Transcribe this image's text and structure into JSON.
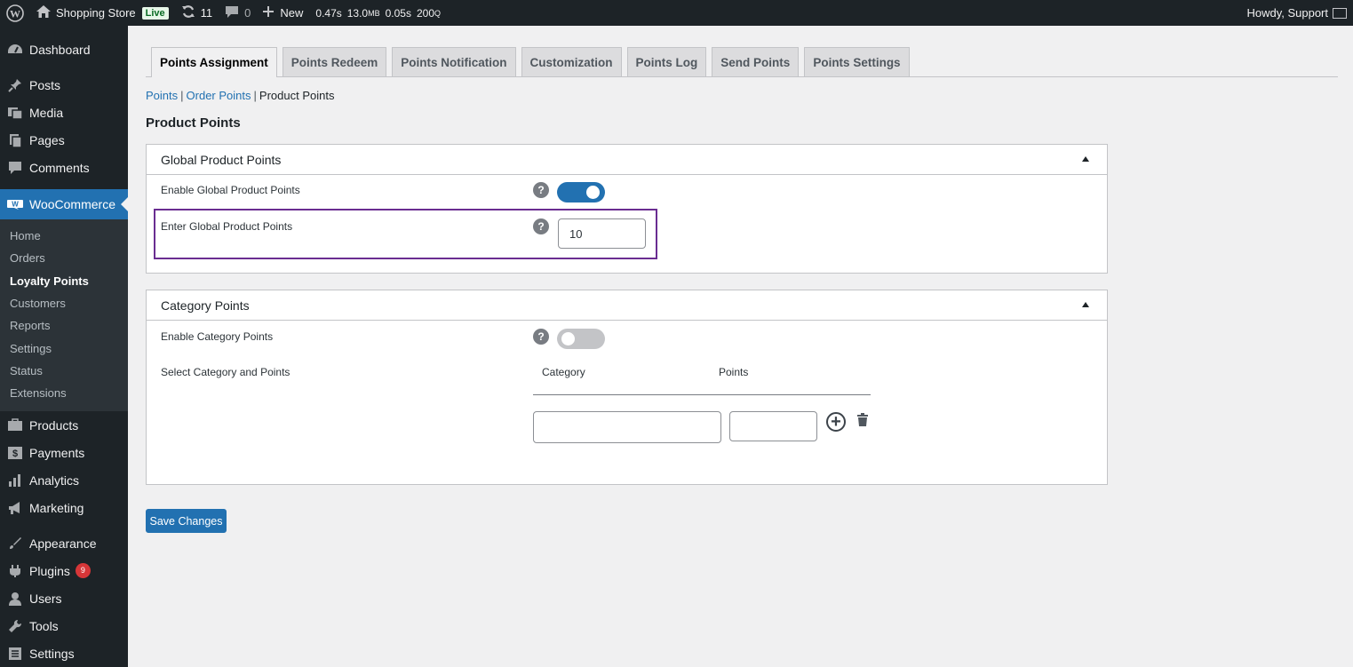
{
  "adminbar": {
    "site_name": "Shopping Store",
    "live_label": "Live",
    "updates_count": "11",
    "comments_count": "0",
    "new_label": "New",
    "perf_time": "0.47s",
    "perf_mem": "13.0",
    "perf_mem_unit": "MB",
    "perf_query_time": "0.05s",
    "perf_queries": "200",
    "perf_queries_unit": "Q",
    "howdy": "Howdy, Support"
  },
  "sidebar": {
    "top_items": [
      {
        "label": "Dashboard",
        "icon": "dashboard-icon"
      },
      {
        "label": "Posts",
        "icon": "pin-icon"
      },
      {
        "label": "Media",
        "icon": "media-icon"
      },
      {
        "label": "Pages",
        "icon": "pages-icon"
      },
      {
        "label": "Comments",
        "icon": "comments-icon"
      }
    ],
    "woocommerce_label": "WooCommerce",
    "woo_submenu": [
      "Home",
      "Orders",
      "Loyalty Points",
      "Customers",
      "Reports",
      "Settings",
      "Status",
      "Extensions"
    ],
    "bottom_items": [
      {
        "label": "Products",
        "icon": "products-icon"
      },
      {
        "label": "Payments",
        "icon": "payments-icon"
      },
      {
        "label": "Analytics",
        "icon": "analytics-icon"
      },
      {
        "label": "Marketing",
        "icon": "marketing-icon"
      },
      {
        "label": "Appearance",
        "icon": "appearance-icon"
      },
      {
        "label": "Plugins",
        "icon": "plugins-icon",
        "badge": "9"
      },
      {
        "label": "Users",
        "icon": "users-icon"
      },
      {
        "label": "Tools",
        "icon": "tools-icon"
      },
      {
        "label": "Settings",
        "icon": "settings-icon"
      }
    ]
  },
  "tabs": [
    "Points Assignment",
    "Points Redeem",
    "Points Notification",
    "Customization",
    "Points Log",
    "Send Points",
    "Points Settings"
  ],
  "breadcrumb": {
    "link1": "Points",
    "link2": "Order Points",
    "current": "Product Points",
    "sep": "|"
  },
  "page_title": "Product Points",
  "global_box": {
    "title": "Global Product Points",
    "enable_label": "Enable Global Product Points",
    "enable_state": "on",
    "points_label": "Enter Global Product Points",
    "points_value": "10"
  },
  "category_box": {
    "title": "Category Points",
    "enable_label": "Enable Category Points",
    "enable_state": "off",
    "select_label": "Select Category and Points",
    "col_category": "Category",
    "col_points": "Points",
    "category_value": "",
    "points_value": ""
  },
  "help_glyph": "?",
  "add_glyph": "+",
  "save_label": "Save Changes",
  "colors": {
    "accent": "#2271b1",
    "highlight": "#6a2d91",
    "adminbar": "#1d2327",
    "badge": "#d63638"
  }
}
